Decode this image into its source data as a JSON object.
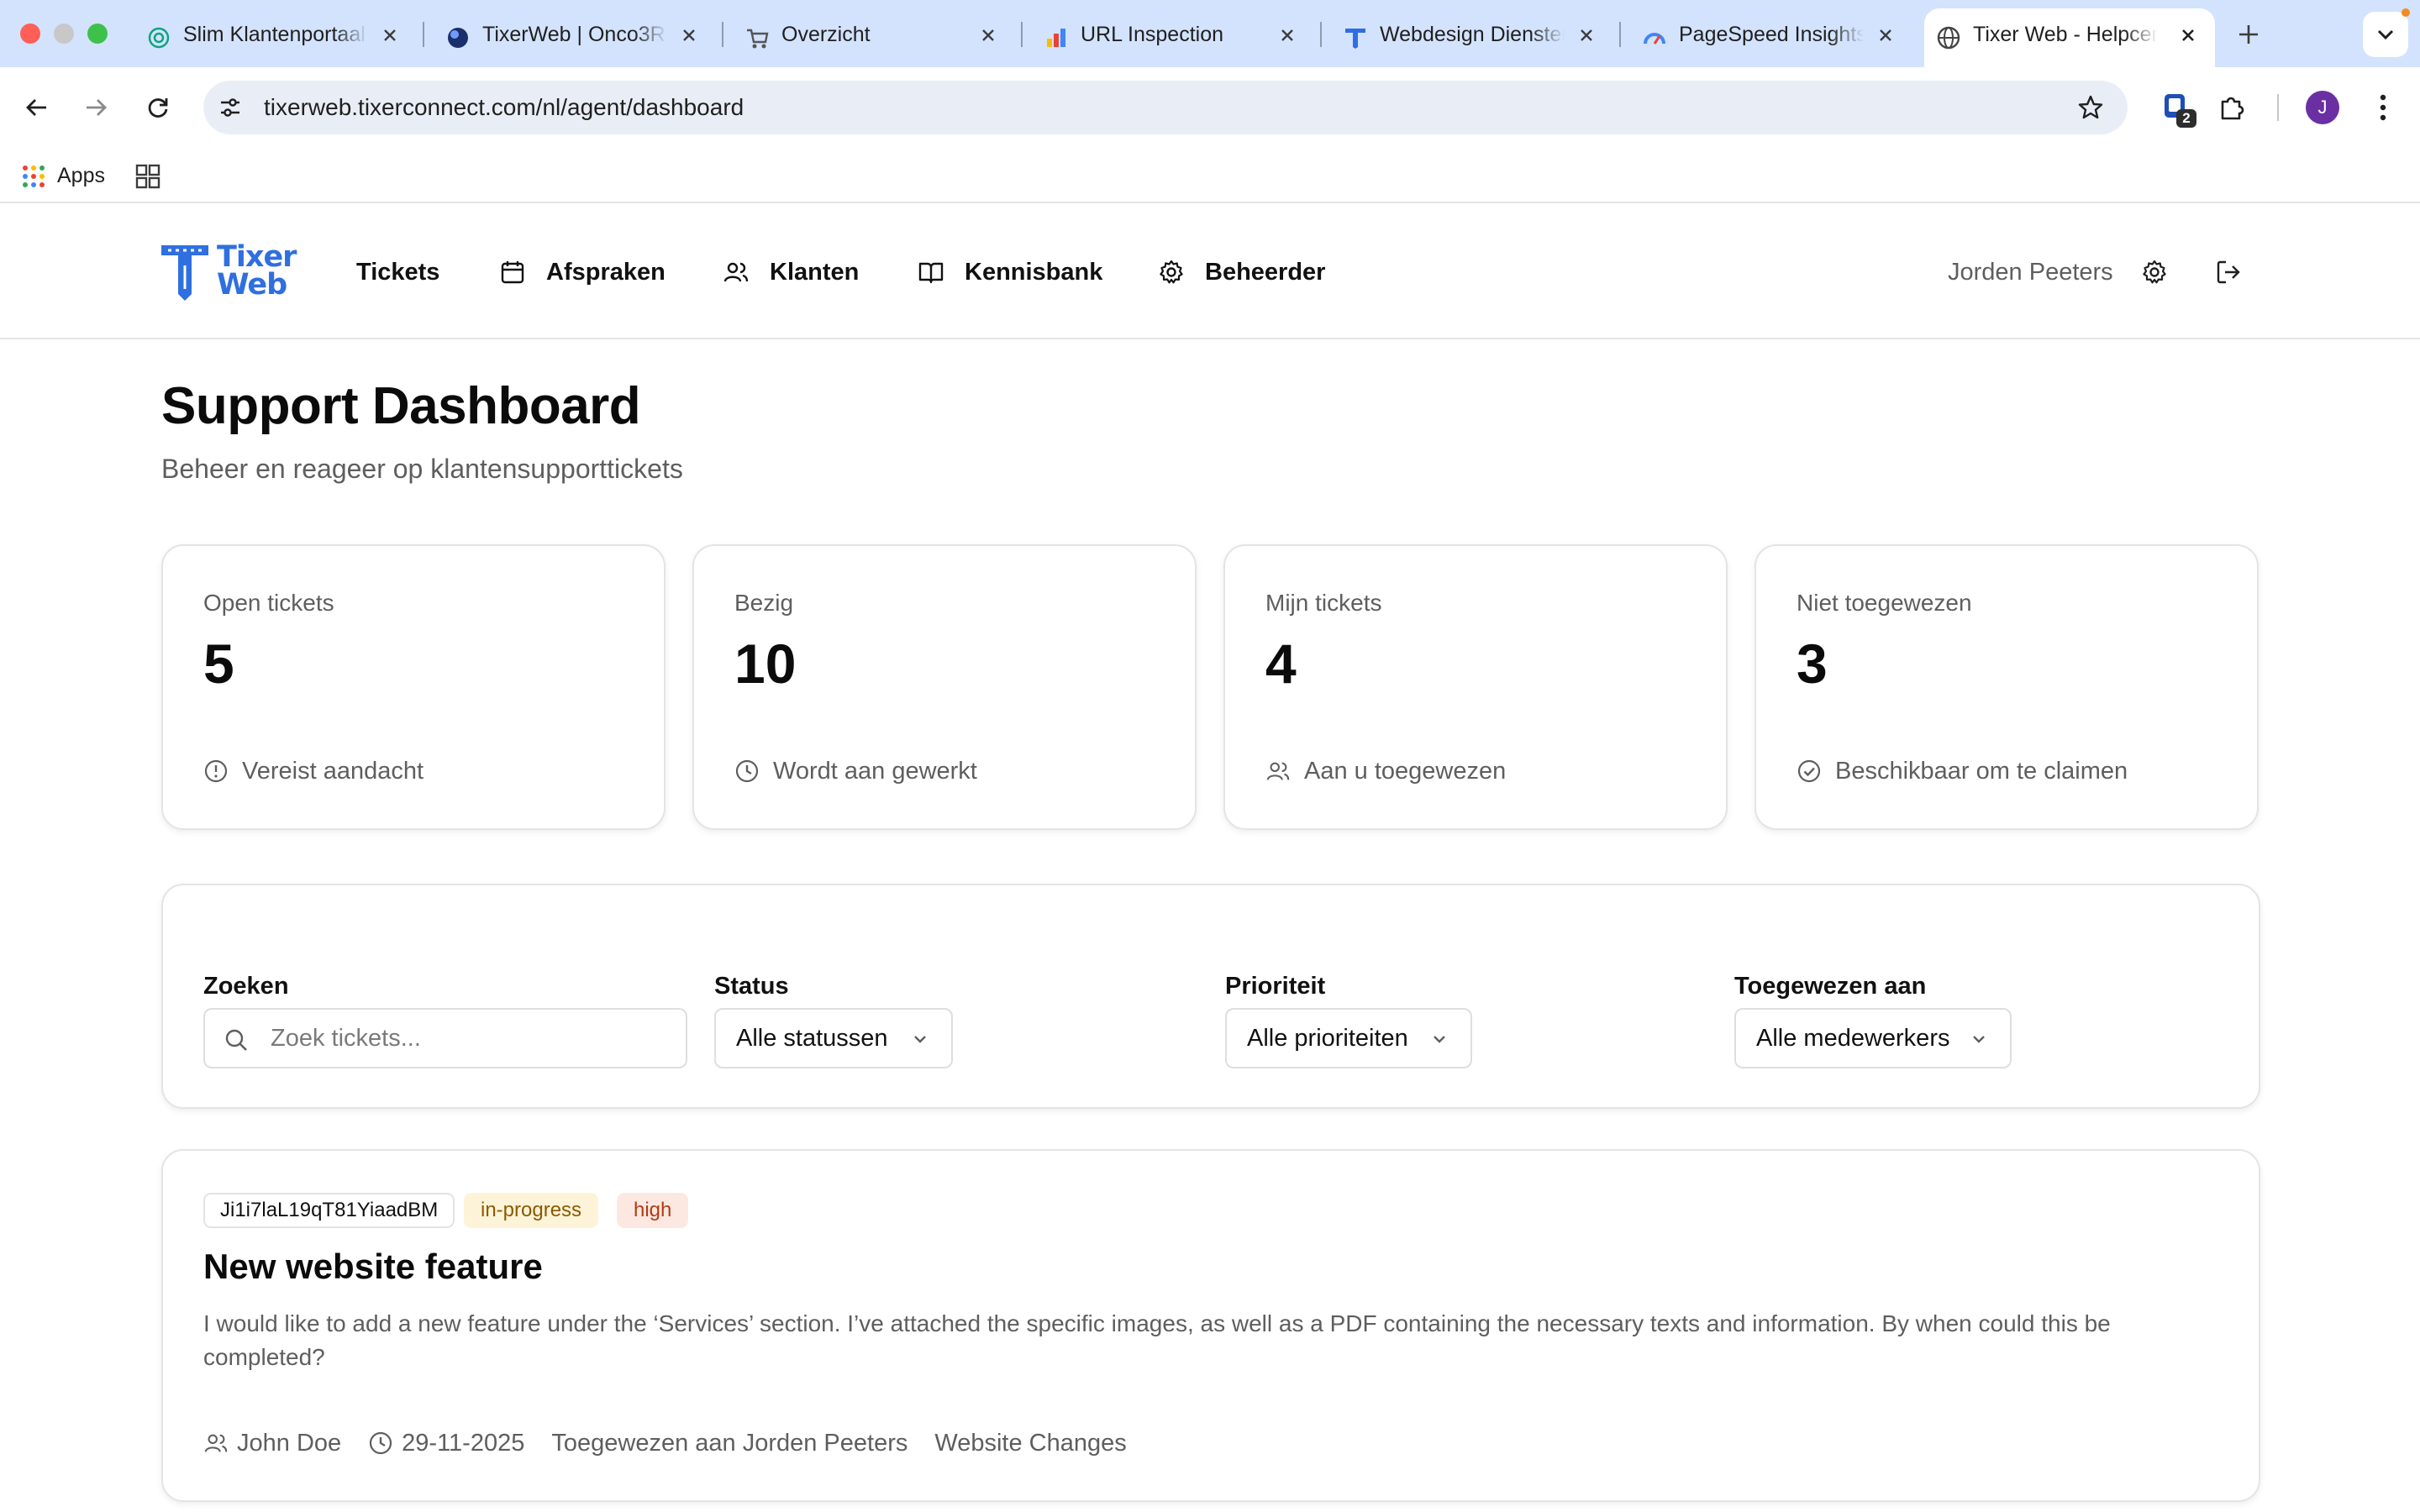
{
  "browser": {
    "tabs": [
      {
        "title": "Slim Klantenportaal",
        "icon": "openai-swirl-icon"
      },
      {
        "title": "TixerWeb | Onco3R",
        "icon": "blue-globe-icon"
      },
      {
        "title": "Overzicht",
        "icon": "shopping-cart-icon"
      },
      {
        "title": "URL Inspection",
        "icon": "search-console-icon"
      },
      {
        "title": "Webdesign Diensten",
        "icon": "tixer-logo-icon"
      },
      {
        "title": "PageSpeed Insights",
        "icon": "pagespeed-gauge-icon"
      },
      {
        "title": "Tixer Web - Helpcenter",
        "icon": "globe-icon",
        "active": true
      }
    ],
    "url": "tixerweb.tixerconnect.com/nl/agent/dashboard",
    "bookmarks": {
      "apps_label": "Apps"
    },
    "extension_badge": "2",
    "profile_initial": "J",
    "colors": {
      "tabbar": "#d3e3fd",
      "omnibox": "#e9eef6",
      "profile": "#6a2fa3"
    }
  },
  "header": {
    "logo": {
      "line1": "Tixer",
      "line2": "Web"
    },
    "nav": [
      {
        "label": "Tickets",
        "icon": ""
      },
      {
        "label": "Afspraken",
        "icon": "calendar-icon"
      },
      {
        "label": "Klanten",
        "icon": "users-icon"
      },
      {
        "label": "Kennisbank",
        "icon": "book-icon"
      },
      {
        "label": "Beheerder",
        "icon": "gear-icon"
      }
    ],
    "user_name": "Jorden Peeters",
    "colors": {
      "brand": "#2f6fe0"
    }
  },
  "page": {
    "title": "Support Dashboard",
    "subtitle": "Beheer en reageer op klantensupporttickets"
  },
  "stats": [
    {
      "label": "Open tickets",
      "value": "5",
      "footer": "Vereist aandacht",
      "icon": "alert-circle-icon"
    },
    {
      "label": "Bezig",
      "value": "10",
      "footer": "Wordt aan gewerkt",
      "icon": "clock-icon"
    },
    {
      "label": "Mijn tickets",
      "value": "4",
      "footer": "Aan u toegewezen",
      "icon": "users-icon"
    },
    {
      "label": "Niet toegewezen",
      "value": "3",
      "footer": "Beschikbaar om te claimen",
      "icon": "check-circle-icon"
    }
  ],
  "filters": {
    "search": {
      "label": "Zoeken",
      "placeholder": "Zoek tickets..."
    },
    "status": {
      "label": "Status",
      "value": "Alle statussen"
    },
    "priority": {
      "label": "Prioriteit",
      "value": "Alle prioriteiten"
    },
    "assignee": {
      "label": "Toegewezen aan",
      "value": "Alle medewerkers"
    }
  },
  "tickets": [
    {
      "id": "Ji1i7laL19qT81YiaadBM",
      "status": "in-progress",
      "priority": "high",
      "title": "New website feature",
      "description": "I would like to add a new feature under the ‘Services’ section. I’ve attached the specific images, as well as a PDF containing the necessary texts and information. By when could this be completed?",
      "customer": "John Doe",
      "date": "29-11-2025",
      "assigned": "Toegewezen aan Jorden Peeters",
      "category": "Website Changes",
      "colors": {
        "status_bg": "#fdf3d8",
        "status_text": "#8a5a00",
        "priority_bg": "#fde8e1",
        "priority_text": "#b33b14"
      }
    }
  ]
}
